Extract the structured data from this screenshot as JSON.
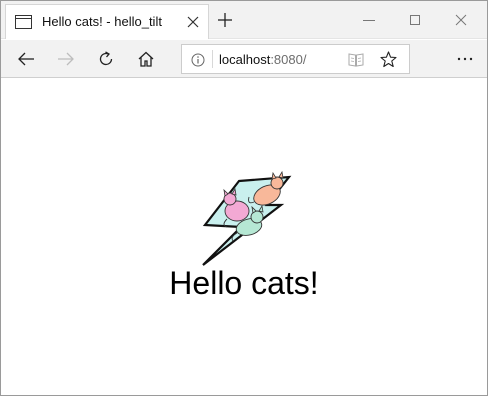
{
  "tab": {
    "title": "Hello cats! - hello_tilt"
  },
  "address_bar": {
    "host": "localhost",
    "rest": ":8080/"
  },
  "page": {
    "heading": "Hello cats!"
  },
  "icons": {
    "tab": "page-icon",
    "close_tab": "close-icon",
    "new_tab": "plus-icon",
    "minimize": "minimize-icon",
    "maximize": "maximize-icon",
    "close_window": "close-icon",
    "back": "back-arrow-icon",
    "forward": "forward-arrow-icon",
    "refresh": "refresh-icon",
    "home": "home-icon",
    "site_info": "info-icon",
    "reading_view": "book-icon",
    "favorite": "star-icon",
    "more": "more-icon",
    "logo": "cats-lightning-logo"
  },
  "colors": {
    "chrome_bg": "#f2f2f2",
    "forward_disabled": "#bdbdbd",
    "lightning_fill": "#c9f0ee",
    "cat_orange": "#f8b89a",
    "cat_pink": "#f3a9d4",
    "cat_mint": "#b6e8d4"
  }
}
